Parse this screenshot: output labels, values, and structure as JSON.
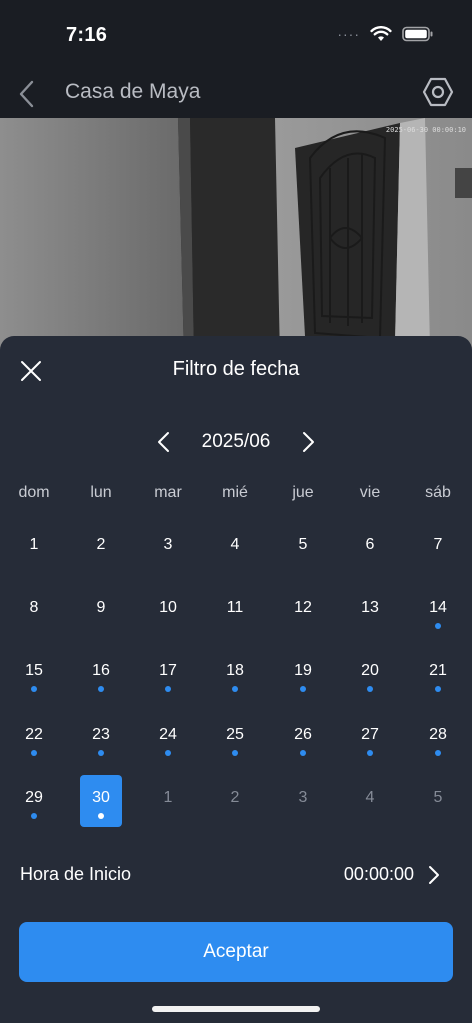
{
  "status_bar": {
    "time": "7:16",
    "signal": "····"
  },
  "nav": {
    "title": "Casa de Maya",
    "back_icon": "chevron-left-icon",
    "settings_icon": "hexagon-settings-icon"
  },
  "camera": {
    "timestamp": "2025-06-30 00:00:10"
  },
  "date_filter": {
    "title": "Filtro de fecha",
    "month": "2025/06",
    "weekdays": [
      "dom",
      "lun",
      "mar",
      "mié",
      "jue",
      "vie",
      "sáb"
    ],
    "weeks": [
      [
        {
          "d": "1"
        },
        {
          "d": "2"
        },
        {
          "d": "3"
        },
        {
          "d": "4"
        },
        {
          "d": "5"
        },
        {
          "d": "6"
        },
        {
          "d": "7"
        }
      ],
      [
        {
          "d": "8"
        },
        {
          "d": "9"
        },
        {
          "d": "10"
        },
        {
          "d": "11"
        },
        {
          "d": "12"
        },
        {
          "d": "13"
        },
        {
          "d": "14",
          "dot": true
        }
      ],
      [
        {
          "d": "15",
          "dot": true
        },
        {
          "d": "16",
          "dot": true
        },
        {
          "d": "17",
          "dot": true
        },
        {
          "d": "18",
          "dot": true
        },
        {
          "d": "19",
          "dot": true
        },
        {
          "d": "20",
          "dot": true
        },
        {
          "d": "21",
          "dot": true
        }
      ],
      [
        {
          "d": "22",
          "dot": true
        },
        {
          "d": "23",
          "dot": true
        },
        {
          "d": "24",
          "dot": true
        },
        {
          "d": "25",
          "dot": true
        },
        {
          "d": "26",
          "dot": true
        },
        {
          "d": "27",
          "dot": true
        },
        {
          "d": "28",
          "dot": true
        }
      ],
      [
        {
          "d": "29",
          "dot": true
        },
        {
          "d": "30",
          "dot": true,
          "selected": true
        },
        {
          "d": "1",
          "muted": true
        },
        {
          "d": "2",
          "muted": true
        },
        {
          "d": "3",
          "muted": true
        },
        {
          "d": "4",
          "muted": true
        },
        {
          "d": "5",
          "muted": true
        }
      ]
    ],
    "start_time_label": "Hora de Inicio",
    "start_time_value": "00:00:00",
    "accept_label": "Aceptar"
  },
  "colors": {
    "accent": "#2e8cf0",
    "sheet_bg": "#262c38",
    "bar_bg": "#1a1d23"
  }
}
